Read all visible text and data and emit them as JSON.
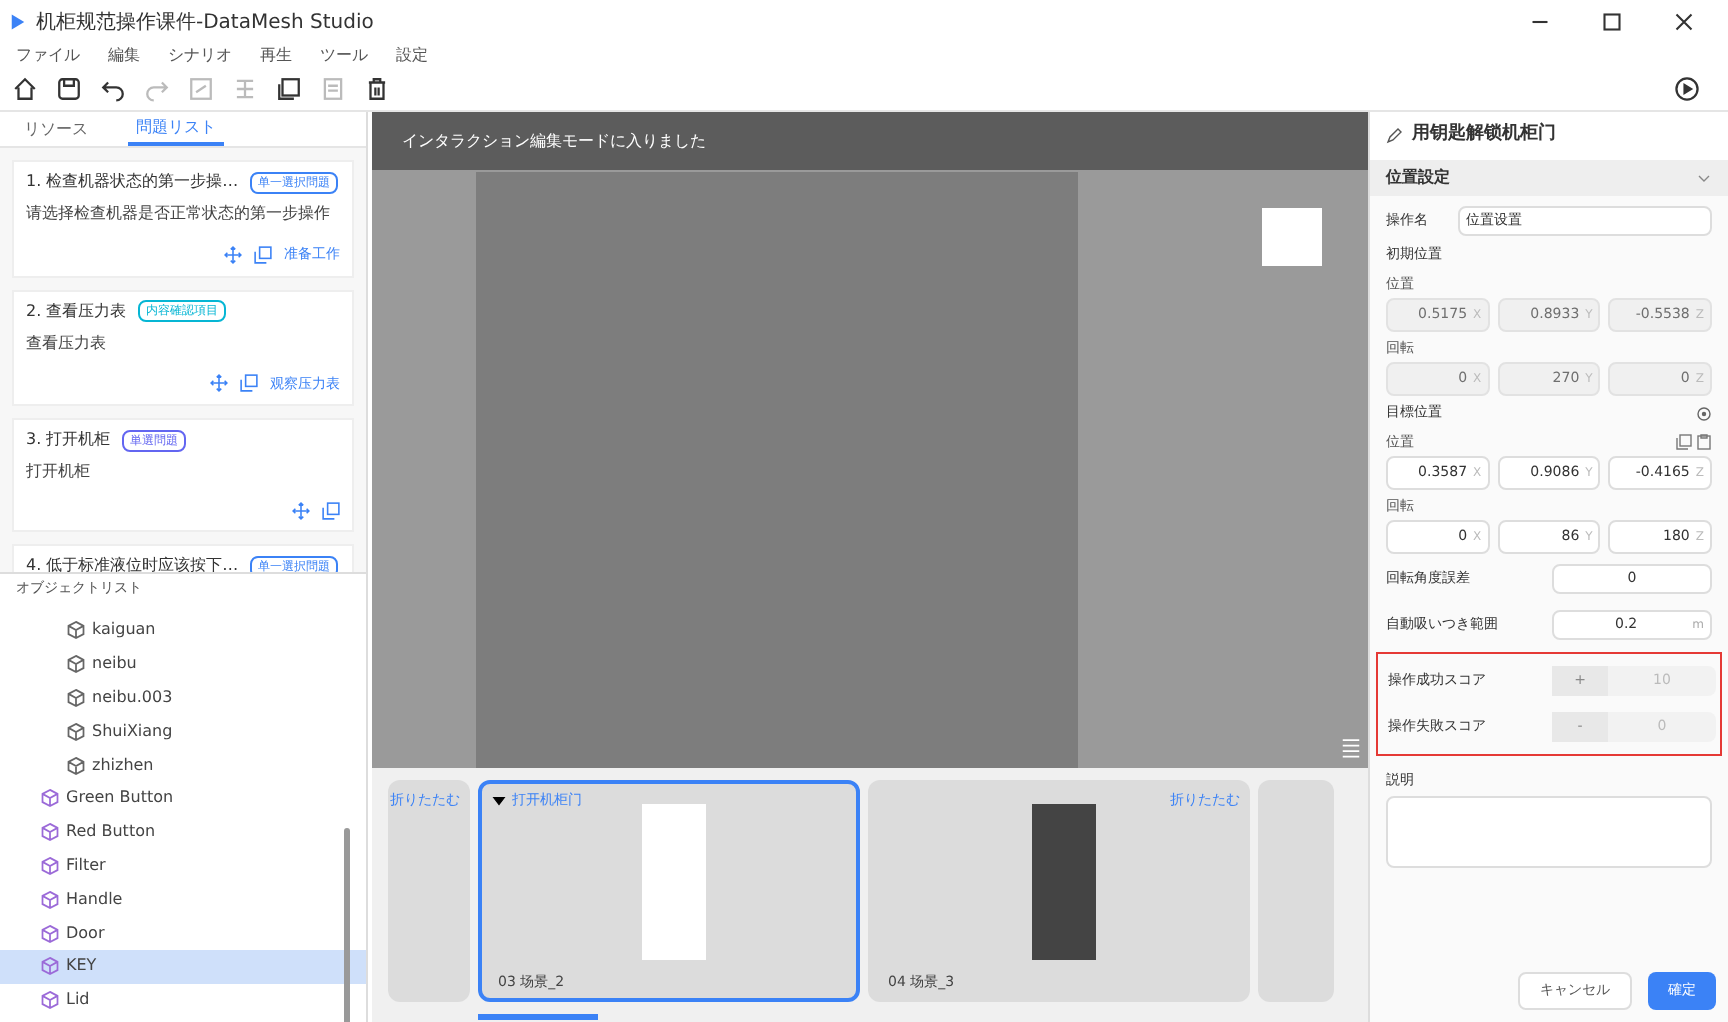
{
  "window": {
    "title": "机柜规范操作课件-DataMesh Studio"
  },
  "menu": [
    "ファイル",
    "編集",
    "シナリオ",
    "再生",
    "ツール",
    "設定"
  ],
  "toolbar": [
    {
      "kind": "home",
      "disabled": false
    },
    {
      "kind": "save",
      "disabled": false
    },
    {
      "kind": "undo",
      "disabled": false
    },
    {
      "kind": "redo",
      "disabled": true
    },
    {
      "kind": "frame",
      "disabled": true
    },
    {
      "kind": "layout",
      "disabled": true
    },
    {
      "kind": "copy",
      "disabled": false
    },
    {
      "kind": "list",
      "disabled": true
    },
    {
      "kind": "trash",
      "disabled": false
    }
  ],
  "tabs": [
    {
      "label": "リソース",
      "selected": false
    },
    {
      "label": "問題リスト",
      "selected": true
    }
  ],
  "questions": [
    {
      "title": "1. 检查机器状态的第一步操…",
      "tag": "单一選択問題",
      "color": "#3b82f6",
      "description": "请选择检查机器是否正常状态的第一步操作",
      "action": "准备工作"
    },
    {
      "title": "2. 查看压力表",
      "tag": "内容確認項目",
      "color": "#06b6d4",
      "description": "查看压力表",
      "action": "观察压力表"
    },
    {
      "title": "3. 打开机柜",
      "tag": "単選問題",
      "color": "#6366f1",
      "description": "打开机柜"
    },
    {
      "title": "4. 低于标准液位时应该按下…",
      "tag": "单一選択問題",
      "color": "#3b82f6"
    }
  ],
  "object_list": {
    "title": "オブジェクトリスト",
    "items": [
      {
        "children": [
          {
            "label": "kaiguan",
            "selected": false
          },
          {
            "label": "neibu",
            "selected": false
          },
          {
            "label": "neibu.003",
            "selected": false
          },
          {
            "label": "ShuiXiang",
            "selected": false
          },
          {
            "label": "zhizhen",
            "selected": false
          }
        ]
      },
      {
        "label": "Green Button",
        "selected": false
      },
      {
        "label": "Red Button",
        "selected": false
      },
      {
        "label": "Filter",
        "selected": false
      },
      {
        "label": "Handle",
        "selected": false
      },
      {
        "label": "Door",
        "selected": false
      },
      {
        "label": "KEY",
        "selected": true
      },
      {
        "label": "Lid",
        "selected": false
      }
    ]
  },
  "viewport": {
    "banner": "インタラクション編集モードに入りました"
  },
  "scenes": [
    {
      "kind": "partial",
      "collapse": "折りたたむ",
      "selected": false
    },
    {
      "kind": "full",
      "title": "打开机柜门",
      "caption": "03  场景_2",
      "selected": true
    },
    {
      "kind": "full",
      "collapse": "折りたたむ",
      "caption": "04  场景_3",
      "selected": false
    },
    {
      "kind": "edge",
      "selected": false
    }
  ],
  "panel": {
    "title": "用钥匙解锁机柜门",
    "section": {
      "title": "位置設定",
      "expanded": true
    },
    "name_label": "操作名",
    "name_value": "位置设置",
    "initial": {
      "title": "初期位置",
      "groups": [
        {
          "label": "位置",
          "fields": [
            {
              "value": "0.5175",
              "axis": "X",
              "disabled": true
            },
            {
              "value": "0.8933",
              "axis": "Y",
              "disabled": true
            },
            {
              "value": "-0.5538",
              "axis": "Z",
              "disabled": true
            }
          ]
        },
        {
          "label": "回転",
          "fields": [
            {
              "value": "0",
              "axis": "X",
              "disabled": true
            },
            {
              "value": "270",
              "axis": "Y",
              "disabled": true
            },
            {
              "value": "0",
              "axis": "Z",
              "disabled": true
            }
          ]
        }
      ]
    },
    "target": {
      "title": "目標位置",
      "groups": [
        {
          "label": "位置",
          "fields": [
            {
              "value": "0.3587",
              "axis": "X",
              "disabled": false
            },
            {
              "value": "0.9086",
              "axis": "Y",
              "disabled": false
            },
            {
              "value": "-0.4165",
              "axis": "Z",
              "disabled": false
            }
          ]
        },
        {
          "label": "回転",
          "fields": [
            {
              "value": "0",
              "axis": "X",
              "disabled": false
            },
            {
              "value": "86",
              "axis": "Y",
              "disabled": false
            },
            {
              "value": "180",
              "axis": "Z",
              "disabled": false
            }
          ]
        }
      ]
    },
    "settings": [
      {
        "label": "回転角度誤差",
        "value": "0"
      },
      {
        "label": "自動吸いつき範囲",
        "value": "0.2",
        "unit": "m"
      }
    ],
    "scores": [
      {
        "label": "操作成功スコア",
        "sign": "+",
        "value": "10",
        "disabled": true
      },
      {
        "label": "操作失敗スコア",
        "sign": "-",
        "value": "0",
        "disabled": true
      }
    ],
    "scores_highlighted": true,
    "description_label": "説明",
    "buttons": [
      {
        "label": "キャンセル",
        "kind": "secondary"
      },
      {
        "label": "確定",
        "kind": "primary"
      }
    ]
  }
}
